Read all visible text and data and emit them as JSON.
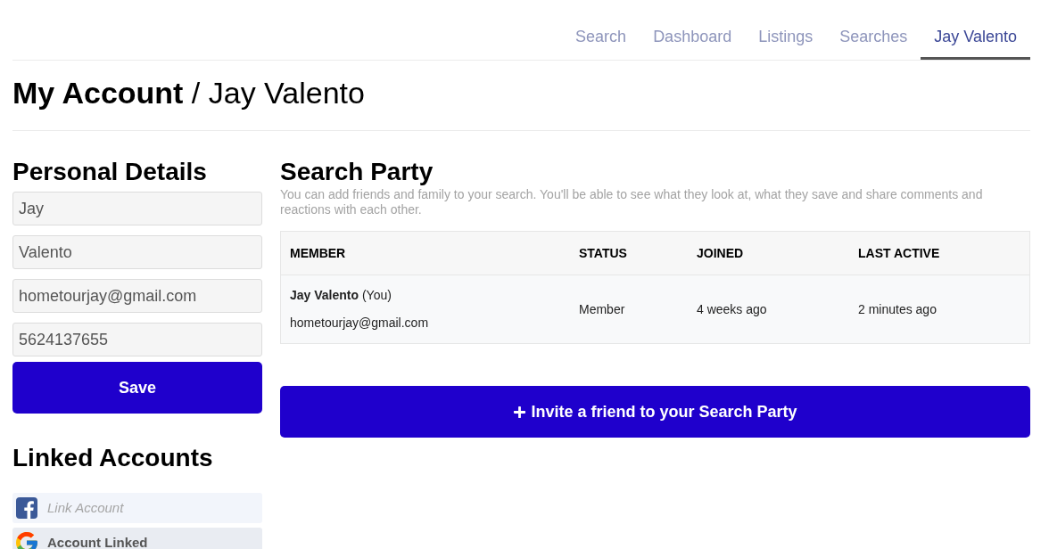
{
  "nav": {
    "tabs": [
      {
        "label": "Search",
        "selected": false
      },
      {
        "label": "Dashboard",
        "selected": false
      },
      {
        "label": "Listings",
        "selected": false
      },
      {
        "label": "Searches",
        "selected": false
      },
      {
        "label": "Jay Valento",
        "selected": true
      }
    ]
  },
  "page_title": "**My Account** / Jay Valento",
  "personal_details": {
    "heading": "Personal Details",
    "fields": [
      {
        "value": "Jay"
      },
      {
        "value": "Valento"
      },
      {
        "value": "hometourjay@gmail.com"
      },
      {
        "value": "5624137655"
      }
    ],
    "save_button": "Save"
  },
  "linked_accounts": {
    "heading": "Linked Accounts",
    "accounts": [
      {
        "kind": "facebook",
        "label": "Link Account",
        "linked": false
      },
      {
        "kind": "google",
        "label": "Account Linked",
        "linked": true
      }
    ]
  },
  "search_party": {
    "heading": "Search Party",
    "description": "You can add friends and family to your search. You'll be able to see what they look at, what they save and share comments and reactions with each other.",
    "table": {
      "columns": [
        "MEMBER",
        "STATUS",
        "JOINED",
        "LAST ACTIVE"
      ],
      "rows": [
        {
          "member": "**Jay Valento** (You)",
          "email": "hometourjay@gmail.com",
          "status": "Member",
          "joined": "4 weeks ago",
          "last_active": "2 minutes ago"
        }
      ]
    },
    "invite_button": "Invite a friend to your Search Party"
  }
}
